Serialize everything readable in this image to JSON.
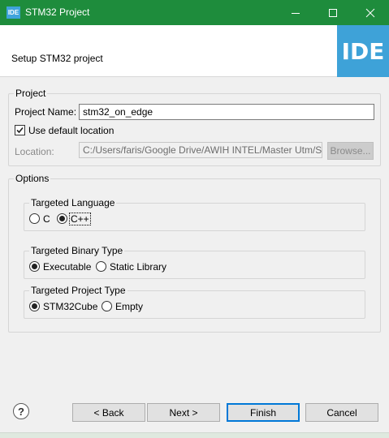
{
  "window": {
    "app_icon_text": "IDE",
    "title": "STM32 Project",
    "controls": [
      "minimize",
      "maximize",
      "close"
    ]
  },
  "header": {
    "title": "Setup STM32 project",
    "logo_text": "IDE"
  },
  "project_group": {
    "label": "Project",
    "name_label": "Project Name:",
    "name_value": "stm32_on_edge",
    "use_default_label": "Use default location",
    "use_default_checked": true,
    "location_label": "Location:",
    "location_value": "C:/Users/faris/Google Drive/AWIH INTEL/Master Utm/S",
    "browse_label": "Browse..."
  },
  "options_group": {
    "label": "Options",
    "language": {
      "label": "Targeted Language",
      "options": [
        "C",
        "C++"
      ],
      "selected": "C++"
    },
    "binary": {
      "label": "Targeted Binary Type",
      "options": [
        "Executable",
        "Static Library"
      ],
      "selected": "Executable"
    },
    "project_type": {
      "label": "Targeted Project Type",
      "options": [
        "STM32Cube",
        "Empty"
      ],
      "selected": "STM32Cube"
    }
  },
  "footer": {
    "help_icon": "?",
    "back_label": "< Back",
    "next_label": "Next >",
    "finish_label": "Finish",
    "cancel_label": "Cancel"
  },
  "colors": {
    "titlebar": "#1e8c3c",
    "logo": "#3ea2d8",
    "default_button_border": "#0078d7"
  }
}
